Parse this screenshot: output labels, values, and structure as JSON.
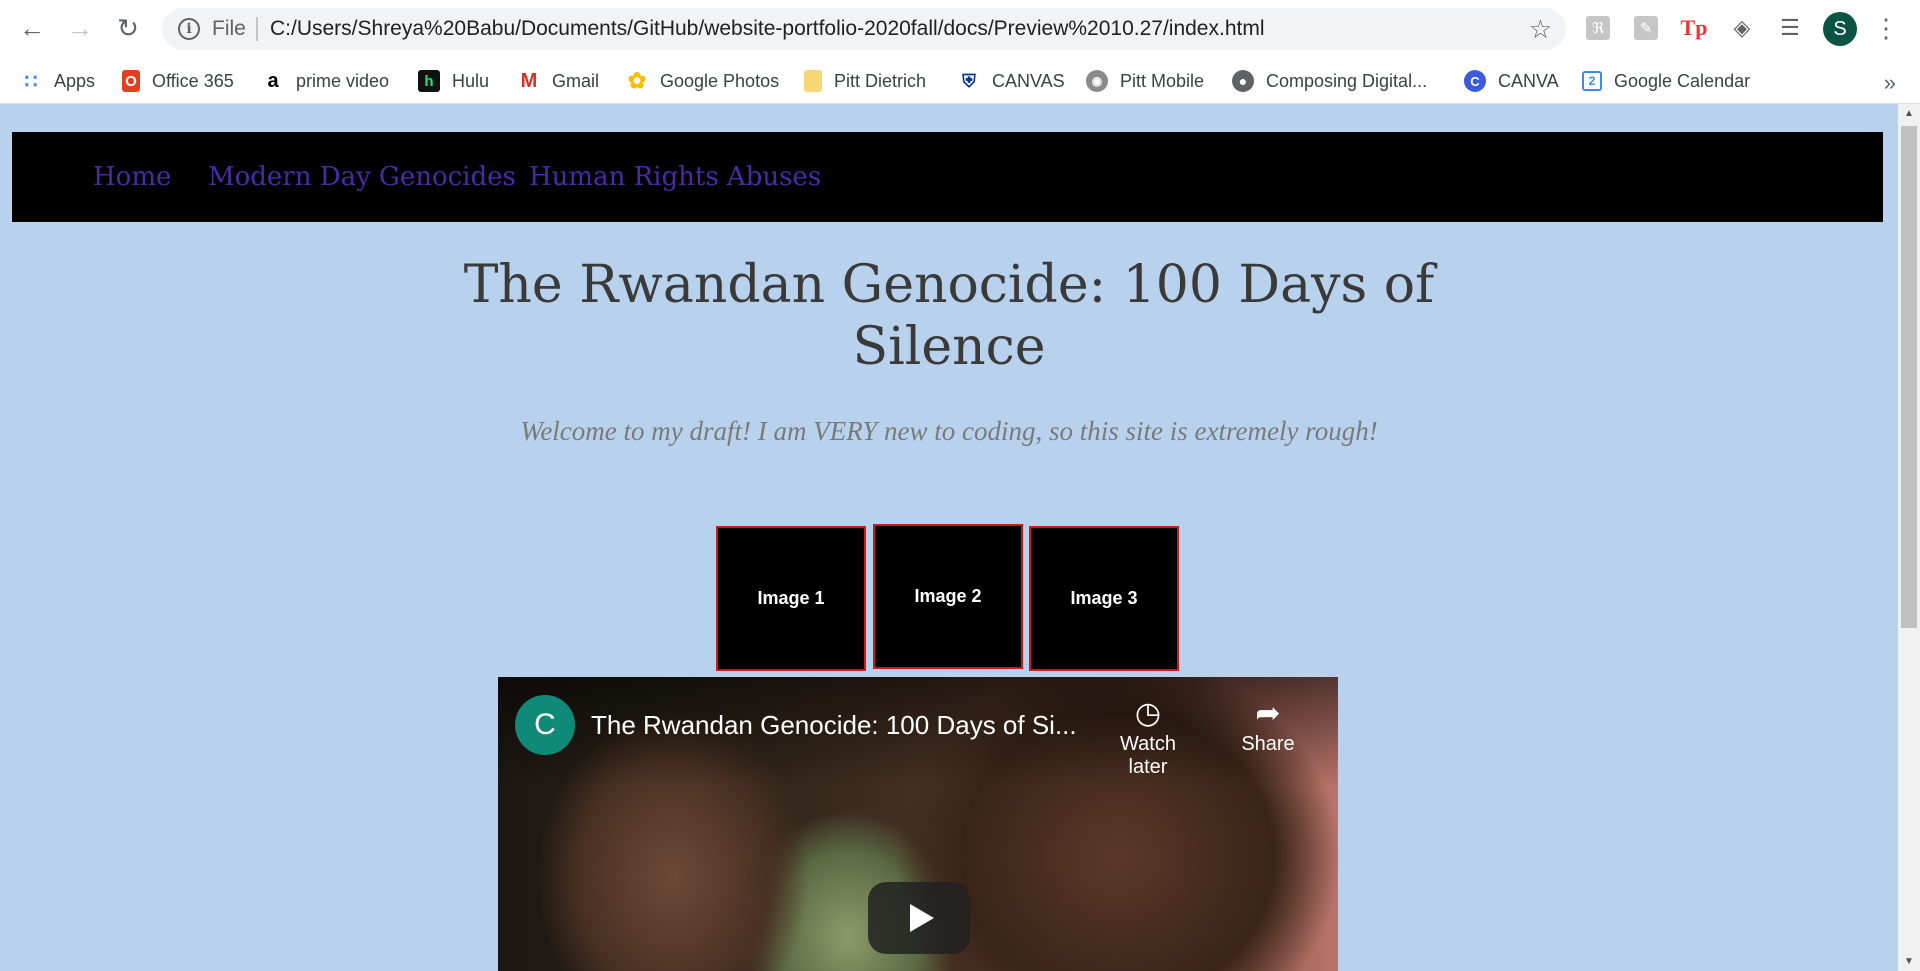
{
  "browser": {
    "omnibox": {
      "scheme_label": "File",
      "url": "C:/Users/Shreya%20Babu/Documents/GitHub/website-portfolio-2020fall/docs/Preview%2010.27/index.html"
    },
    "profile_initial": "S",
    "bookmarks": [
      {
        "label": "Apps",
        "icon": "apps-grid-icon"
      },
      {
        "label": "Office 365",
        "icon": "office-icon"
      },
      {
        "label": "prime video",
        "icon": "amazon-icon"
      },
      {
        "label": "Hulu",
        "icon": "hulu-icon"
      },
      {
        "label": "Gmail",
        "icon": "gmail-icon"
      },
      {
        "label": "Google Photos",
        "icon": "google-photos-icon"
      },
      {
        "label": "Pitt Dietrich",
        "icon": "folder-icon"
      },
      {
        "label": "CANVAS",
        "icon": "pitt-seal-icon"
      },
      {
        "label": "Pitt Mobile",
        "icon": "pitt-mobile-icon"
      },
      {
        "label": "Composing Digital...",
        "icon": "globe-icon"
      },
      {
        "label": "CANVA",
        "icon": "canva-icon"
      },
      {
        "label": "Google Calendar",
        "icon": "google-calendar-icon"
      }
    ],
    "colors": {
      "page_background": "#b8d1ed",
      "nav_background": "#000000",
      "nav_link": "#4b2aa8",
      "thumb_border": "#d01818"
    }
  },
  "site": {
    "nav": [
      "Home",
      "Modern Day Genocides",
      "Human Rights Abuses"
    ],
    "title_line1": "The Rwandan Genocide: 100 Days of",
    "title_line2": "Silence",
    "subtitle": "Welcome to my draft! I am VERY new to coding, so this site is extremely rough!",
    "images": [
      "Image 1",
      "Image 2",
      "Image 3"
    ],
    "video": {
      "channel_initial": "C",
      "title": "The Rwandan Genocide: 100 Days of Si...",
      "watch_later": "Watch later",
      "share": "Share"
    }
  }
}
